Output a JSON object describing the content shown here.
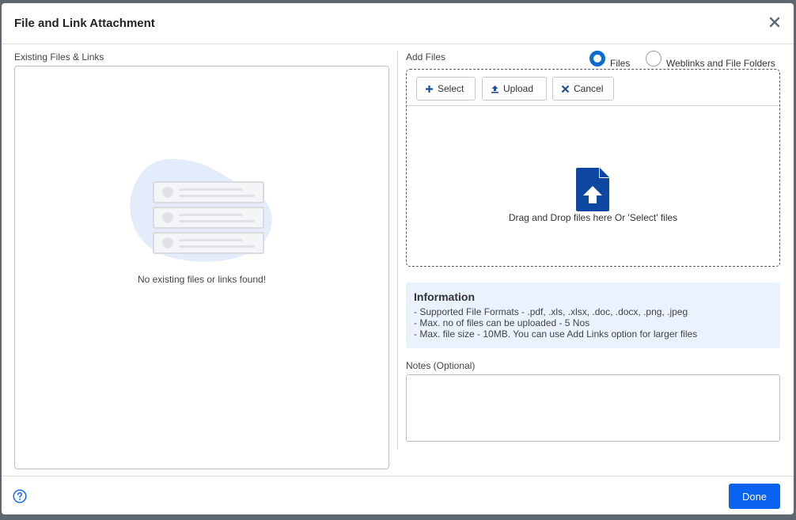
{
  "dialog": {
    "title": "File and Link Attachment",
    "close_icon": "close-icon"
  },
  "existing": {
    "label": "Existing Files & Links",
    "empty_text": "No existing files or links found!"
  },
  "add_files": {
    "label": "Add Files",
    "mode_options": [
      {
        "label": "Files",
        "checked": true
      },
      {
        "label": "Weblinks and File Folders",
        "checked": false
      }
    ],
    "toolbar": {
      "select_label": "Select",
      "upload_label": "Upload",
      "cancel_label": "Cancel"
    },
    "drop_text": "Drag and Drop files here Or 'Select' files"
  },
  "information": {
    "title": "Information",
    "lines": [
      "- Supported File Formats - .pdf, .xls, .xlsx, .doc, .docx, .png, .jpeg",
      "- Max. no of files can be uploaded - 5 Nos",
      "- Max. file size - 10MB. You can use Add Links option for larger files"
    ]
  },
  "notes": {
    "label": "Notes (Optional)",
    "value": ""
  },
  "footer": {
    "done_label": "Done",
    "help_icon": "help-icon"
  },
  "colors": {
    "primary": "#0a63f0",
    "radio_checked": "#0a6ed1",
    "file_icon": "#0d47a1",
    "info_bg": "#e9f2fd"
  }
}
